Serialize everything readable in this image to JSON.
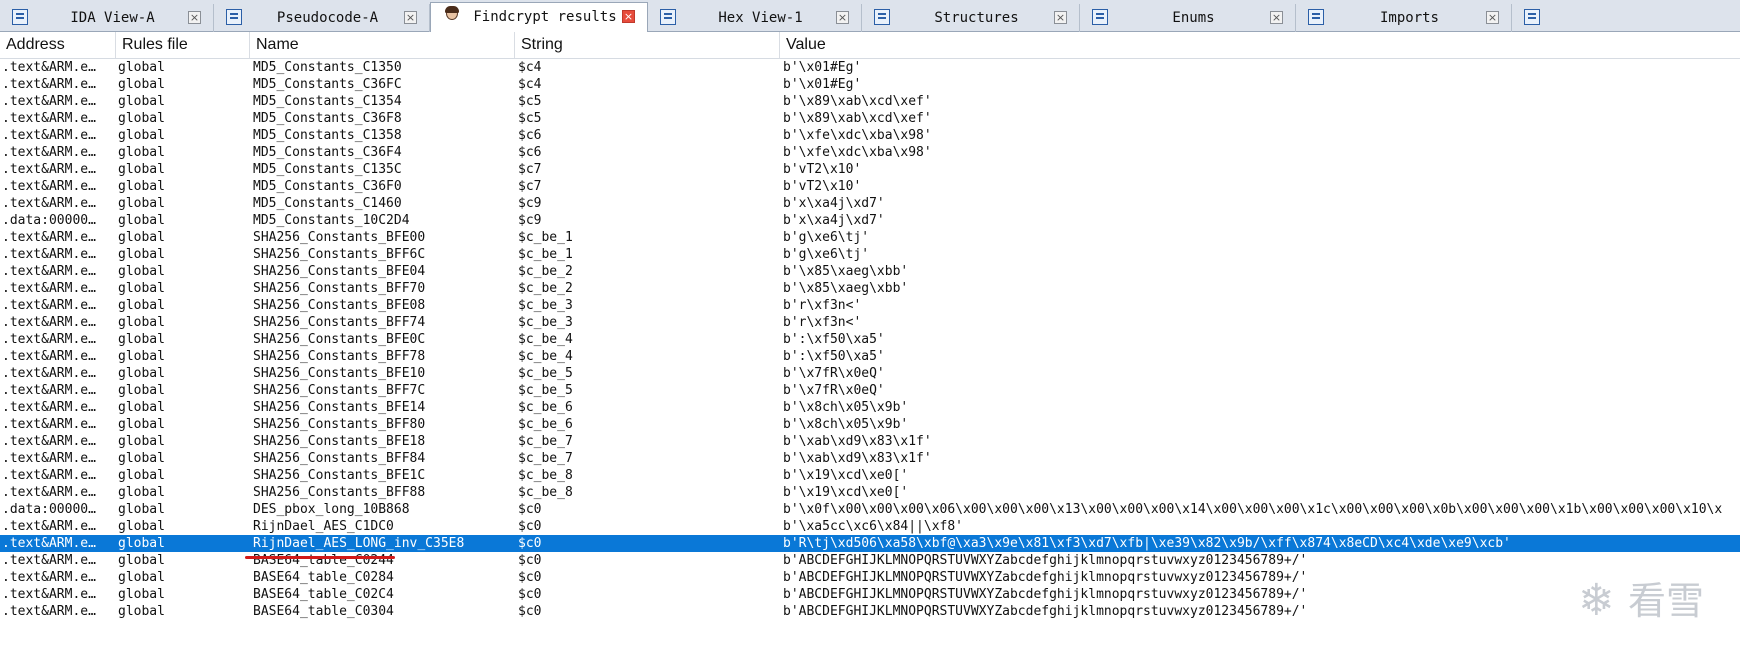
{
  "tabs": [
    {
      "label": "IDA View-A",
      "icon": "ida-view-icon",
      "active": false
    },
    {
      "label": "Pseudocode-A",
      "icon": "pseudocode-icon",
      "active": false
    },
    {
      "label": "Findcrypt results",
      "icon": "findcrypt-icon",
      "active": true
    },
    {
      "label": "Hex View-1",
      "icon": "hex-view-icon",
      "active": false
    },
    {
      "label": "Structures",
      "icon": "structures-icon",
      "active": false
    },
    {
      "label": "Enums",
      "icon": "enums-icon",
      "active": false
    },
    {
      "label": "Imports",
      "icon": "imports-icon",
      "active": false
    }
  ],
  "columns": [
    "Address",
    "Rules file",
    "Name",
    "String",
    "Value"
  ],
  "rows": [
    {
      "address": ".text&ARM.e…",
      "rules": "global",
      "name": "MD5_Constants_C1350",
      "string": "$c4",
      "value": "b'\\x01#Eg'"
    },
    {
      "address": ".text&ARM.e…",
      "rules": "global",
      "name": "MD5_Constants_C36FC",
      "string": "$c4",
      "value": "b'\\x01#Eg'"
    },
    {
      "address": ".text&ARM.e…",
      "rules": "global",
      "name": "MD5_Constants_C1354",
      "string": "$c5",
      "value": "b'\\x89\\xab\\xcd\\xef'"
    },
    {
      "address": ".text&ARM.e…",
      "rules": "global",
      "name": "MD5_Constants_C36F8",
      "string": "$c5",
      "value": "b'\\x89\\xab\\xcd\\xef'"
    },
    {
      "address": ".text&ARM.e…",
      "rules": "global",
      "name": "MD5_Constants_C1358",
      "string": "$c6",
      "value": "b'\\xfe\\xdc\\xba\\x98'"
    },
    {
      "address": ".text&ARM.e…",
      "rules": "global",
      "name": "MD5_Constants_C36F4",
      "string": "$c6",
      "value": "b'\\xfe\\xdc\\xba\\x98'"
    },
    {
      "address": ".text&ARM.e…",
      "rules": "global",
      "name": "MD5_Constants_C135C",
      "string": "$c7",
      "value": "b'vT2\\x10'"
    },
    {
      "address": ".text&ARM.e…",
      "rules": "global",
      "name": "MD5_Constants_C36F0",
      "string": "$c7",
      "value": "b'vT2\\x10'"
    },
    {
      "address": ".text&ARM.e…",
      "rules": "global",
      "name": "MD5_Constants_C1460",
      "string": "$c9",
      "value": "b'x\\xa4j\\xd7'"
    },
    {
      "address": ".data:00000…",
      "rules": "global",
      "name": "MD5_Constants_10C2D4",
      "string": "$c9",
      "value": "b'x\\xa4j\\xd7'"
    },
    {
      "address": ".text&ARM.e…",
      "rules": "global",
      "name": "SHA256_Constants_BFE00",
      "string": "$c_be_1",
      "value": "b'g\\xe6\\tj'"
    },
    {
      "address": ".text&ARM.e…",
      "rules": "global",
      "name": "SHA256_Constants_BFF6C",
      "string": "$c_be_1",
      "value": "b'g\\xe6\\tj'"
    },
    {
      "address": ".text&ARM.e…",
      "rules": "global",
      "name": "SHA256_Constants_BFE04",
      "string": "$c_be_2",
      "value": "b'\\x85\\xaeg\\xbb'"
    },
    {
      "address": ".text&ARM.e…",
      "rules": "global",
      "name": "SHA256_Constants_BFF70",
      "string": "$c_be_2",
      "value": "b'\\x85\\xaeg\\xbb'"
    },
    {
      "address": ".text&ARM.e…",
      "rules": "global",
      "name": "SHA256_Constants_BFE08",
      "string": "$c_be_3",
      "value": "b'r\\xf3n<'"
    },
    {
      "address": ".text&ARM.e…",
      "rules": "global",
      "name": "SHA256_Constants_BFF74",
      "string": "$c_be_3",
      "value": "b'r\\xf3n<'"
    },
    {
      "address": ".text&ARM.e…",
      "rules": "global",
      "name": "SHA256_Constants_BFE0C",
      "string": "$c_be_4",
      "value": "b':\\xf50\\xa5'"
    },
    {
      "address": ".text&ARM.e…",
      "rules": "global",
      "name": "SHA256_Constants_BFF78",
      "string": "$c_be_4",
      "value": "b':\\xf50\\xa5'"
    },
    {
      "address": ".text&ARM.e…",
      "rules": "global",
      "name": "SHA256_Constants_BFE10",
      "string": "$c_be_5",
      "value": "b'\\x7fR\\x0eQ'"
    },
    {
      "address": ".text&ARM.e…",
      "rules": "global",
      "name": "SHA256_Constants_BFF7C",
      "string": "$c_be_5",
      "value": "b'\\x7fR\\x0eQ'"
    },
    {
      "address": ".text&ARM.e…",
      "rules": "global",
      "name": "SHA256_Constants_BFE14",
      "string": "$c_be_6",
      "value": "b'\\x8ch\\x05\\x9b'"
    },
    {
      "address": ".text&ARM.e…",
      "rules": "global",
      "name": "SHA256_Constants_BFF80",
      "string": "$c_be_6",
      "value": "b'\\x8ch\\x05\\x9b'"
    },
    {
      "address": ".text&ARM.e…",
      "rules": "global",
      "name": "SHA256_Constants_BFE18",
      "string": "$c_be_7",
      "value": "b'\\xab\\xd9\\x83\\x1f'"
    },
    {
      "address": ".text&ARM.e…",
      "rules": "global",
      "name": "SHA256_Constants_BFF84",
      "string": "$c_be_7",
      "value": "b'\\xab\\xd9\\x83\\x1f'"
    },
    {
      "address": ".text&ARM.e…",
      "rules": "global",
      "name": "SHA256_Constants_BFE1C",
      "string": "$c_be_8",
      "value": "b'\\x19\\xcd\\xe0['"
    },
    {
      "address": ".text&ARM.e…",
      "rules": "global",
      "name": "SHA256_Constants_BFF88",
      "string": "$c_be_8",
      "value": "b'\\x19\\xcd\\xe0['"
    },
    {
      "address": ".data:00000…",
      "rules": "global",
      "name": "DES_pbox_long_10B868",
      "string": "$c0",
      "value": "b'\\x0f\\x00\\x00\\x00\\x06\\x00\\x00\\x00\\x13\\x00\\x00\\x00\\x14\\x00\\x00\\x00\\x1c\\x00\\x00\\x00\\x0b\\x00\\x00\\x00\\x1b\\x00\\x00\\x00\\x10\\x"
    },
    {
      "address": ".text&ARM.e…",
      "rules": "global",
      "name": "RijnDael_AES_C1DC0",
      "string": "$c0",
      "value": "b'\\xa5cc\\xc6\\x84||\\xf8'"
    },
    {
      "address": ".text&ARM.e…",
      "rules": "global",
      "name": "RijnDael_AES_LONG_inv_C35E8",
      "string": "$c0",
      "value": "b'R\\tj\\xd506\\xa58\\xbf@\\xa3\\x9e\\x81\\xf3\\xd7\\xfb|\\xe39\\x82\\x9b/\\xff\\x874\\x8eCD\\xc4\\xde\\xe9\\xcb'",
      "selected": true
    },
    {
      "address": ".text&ARM.e…",
      "rules": "global",
      "name": "BASE64_table_C0244",
      "string": "$c0",
      "value": "b'ABCDEFGHIJKLMNOPQRSTUVWXYZabcdefghijklmnopqrstuvwxyz0123456789+/'"
    },
    {
      "address": ".text&ARM.e…",
      "rules": "global",
      "name": "BASE64_table_C0284",
      "string": "$c0",
      "value": "b'ABCDEFGHIJKLMNOPQRSTUVWXYZabcdefghijklmnopqrstuvwxyz0123456789+/'"
    },
    {
      "address": ".text&ARM.e…",
      "rules": "global",
      "name": "BASE64_table_C02C4",
      "string": "$c0",
      "value": "b'ABCDEFGHIJKLMNOPQRSTUVWXYZabcdefghijklmnopqrstuvwxyz0123456789+/'"
    },
    {
      "address": ".text&ARM.e…",
      "rules": "global",
      "name": "BASE64_table_C0304",
      "string": "$c0",
      "value": "b'ABCDEFGHIJKLMNOPQRSTUVWXYZabcdefghijklmnopqrstuvwxyz0123456789+/'"
    }
  ],
  "watermark": {
    "icon": "snowflake-logo-icon",
    "glyph": "❄",
    "text": "看雪"
  },
  "colors": {
    "selection": "#0a78d7",
    "annotation_underline": "#d11919"
  }
}
